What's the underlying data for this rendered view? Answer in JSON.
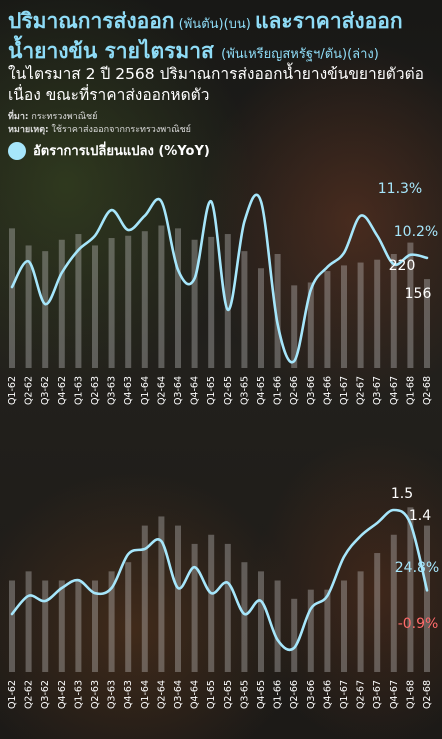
{
  "title": {
    "line1_main": "ปริมาณการส่งออก",
    "line1_unit": " (พันตัน)(บน) ",
    "line1_main2": "และราคาส่งออก",
    "line2_main": "น้ำยางข้น รายไตรมาส ",
    "line2_unit": "(พันเหรียญสหรัฐฯ/ตัน)(ล่าง)"
  },
  "subtitle": "ในไตรมาส 2 ปี 2568 ปริมาณการส่งออกน้ำยางข้นขยายตัวต่อเนื่อง ขณะที่ราคาส่งออกหดตัว",
  "source_label": "ที่มา:",
  "source_text": " กระทรวงพาณิชย์",
  "note_label": "หมายเหตุ:",
  "note_text": " ใช้ราคาส่งออกจากกระทรวงพาณิชย์",
  "legend_label": "อัตราการเปลี่ยนแปลง (%YoY)",
  "colors": {
    "line": "#a6e6fb",
    "bar": "#d9d9d9",
    "negative": "#ff6b6b",
    "label": "#a6e6fb"
  },
  "chart_data": [
    {
      "type": "bar",
      "title": "ปริมาณการส่งออก (พันตัน)",
      "categories": [
        "Q1-62",
        "Q2-62",
        "Q3-62",
        "Q4-62",
        "Q1-63",
        "Q2-63",
        "Q3-63",
        "Q4-63",
        "Q1-64",
        "Q2-64",
        "Q3-64",
        "Q4-64",
        "Q1-65",
        "Q2-65",
        "Q3-65",
        "Q4-65",
        "Q1-66",
        "Q2-66",
        "Q3-66",
        "Q4-66",
        "Q1-67",
        "Q2-67",
        "Q3-67",
        "Q4-67",
        "Q1-68",
        "Q2-68"
      ],
      "series": [
        {
          "values": [
            245,
            215,
            205,
            225,
            235,
            215,
            228,
            232,
            240,
            250,
            245,
            225,
            230,
            235,
            205,
            175,
            200,
            145,
            150,
            170,
            180,
            185,
            190,
            200,
            220,
            156
          ]
        },
        {
          "values": [
            0,
            9,
            -6,
            5,
            13,
            18,
            27,
            20,
            25,
            30,
            6,
            3,
            30,
            -8,
            23,
            30,
            -13,
            -26,
            -1,
            7,
            12,
            25,
            18,
            8,
            11.3,
            10.2
          ]
        }
      ],
      "annotations": [
        "11.3%",
        "10.2%",
        "220",
        "156"
      ]
    },
    {
      "type": "bar",
      "title": "ราคาส่งออก (พันเหรียญสหรัฐฯ/ตัน)",
      "categories": [
        "Q1-62",
        "Q2-62",
        "Q3-62",
        "Q4-62",
        "Q1-63",
        "Q2-63",
        "Q3-63",
        "Q4-63",
        "Q1-64",
        "Q2-64",
        "Q3-64",
        "Q4-64",
        "Q1-65",
        "Q2-65",
        "Q3-65",
        "Q4-65",
        "Q1-66",
        "Q2-66",
        "Q3-66",
        "Q4-66",
        "Q1-67",
        "Q2-67",
        "Q3-67",
        "Q4-67",
        "Q1-68",
        "Q2-68"
      ],
      "series": [
        {
          "values": [
            1.1,
            1.15,
            1.1,
            1.1,
            1.1,
            1.1,
            1.15,
            1.2,
            1.4,
            1.45,
            1.4,
            1.3,
            1.35,
            1.3,
            1.2,
            1.15,
            1.1,
            1.0,
            1.05,
            1.05,
            1.1,
            1.15,
            1.25,
            1.35,
            1.5,
            1.4
          ]
        },
        {
          "values": [
            -10,
            -3,
            -5,
            0,
            3,
            -2,
            0,
            13,
            15,
            18,
            0,
            8,
            -2,
            2,
            -10,
            -5,
            -20,
            -23,
            -8,
            -3,
            12,
            20,
            25,
            30,
            24.8,
            -0.9
          ]
        }
      ],
      "annotations": [
        "1.5",
        "1.4",
        "24.8%",
        "-0.9%"
      ]
    }
  ]
}
